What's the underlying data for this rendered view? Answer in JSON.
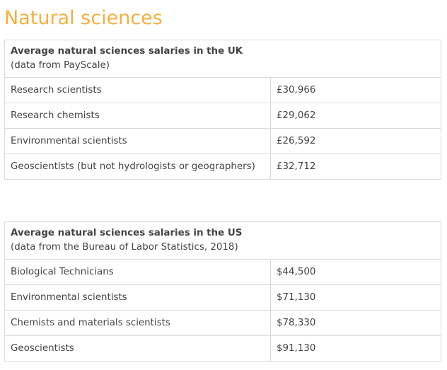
{
  "page_title": "Natural sciences",
  "uk_table": {
    "heading": "Average natural sciences salaries in the UK",
    "source": "(data from PayScale)",
    "rows": [
      {
        "role": "Research scientists",
        "salary": "£30,966"
      },
      {
        "role": "Research chemists",
        "salary": "£29,062"
      },
      {
        "role": "Environmental scientists",
        "salary": "£26,592"
      },
      {
        "role": "Geoscientists (but not hydrologists or geographers)",
        "salary": "£32,712"
      }
    ]
  },
  "us_table": {
    "heading": "Average natural sciences salaries in the US",
    "source": "(data from the Bureau of Labor Statistics, 2018)",
    "rows": [
      {
        "role": "Biological Technicians",
        "salary": "$44,500"
      },
      {
        "role": "Environmental scientists",
        "salary": "$71,130"
      },
      {
        "role": "Chemists and materials scientists",
        "salary": "$78,330"
      },
      {
        "role": "Geoscientists",
        "salary": "$91,130"
      }
    ]
  },
  "colors": {
    "title": "#f4b03e",
    "text": "#444444",
    "border": "#d9d9d9"
  }
}
